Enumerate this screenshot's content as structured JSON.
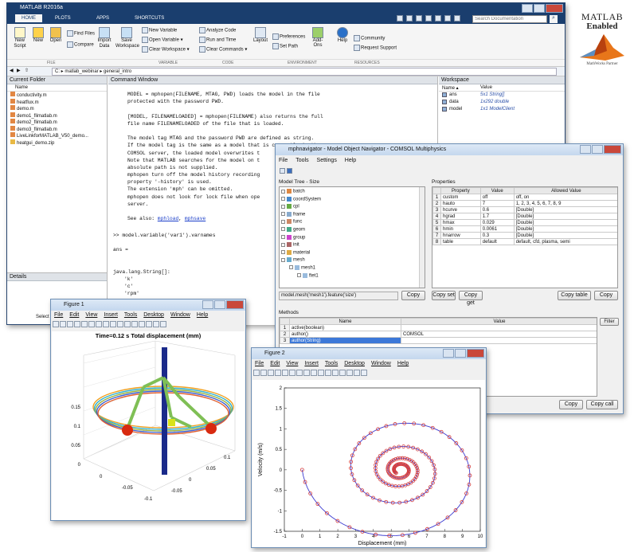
{
  "matlab": {
    "title": "MATLAB R2016a",
    "tabs": [
      "HOME",
      "PLOTS",
      "APPS",
      "SHORTCUTS"
    ],
    "search_placeholder": "Search Documentation",
    "ribbon": {
      "new_script": "New Script",
      "new": "New",
      "open": "Open",
      "find_files": "Find Files",
      "compare": "Compare",
      "import_data": "Import Data",
      "save_workspace": "Save Workspace",
      "new_variable": "New Variable",
      "open_variable": "Open Variable",
      "clear_workspace": "Clear Workspace",
      "analyze_code": "Analyze Code",
      "run_and_time": "Run and Time",
      "clear_commands": "Clear Commands",
      "layout": "Layout",
      "preferences": "Preferences",
      "set_path": "Set Path",
      "addons": "Add-Ons",
      "help": "Help",
      "community": "Community",
      "request_support": "Request Support",
      "groups": [
        "FILE",
        "VARIABLE",
        "CODE",
        "ENVIRONMENT",
        "RESOURCES"
      ]
    },
    "path": "C: ▸ matlab_webinar ▸ general_intro",
    "current_folder": {
      "title": "Current Folder",
      "col": "Name",
      "files": [
        "conductivity.m",
        "heatflux.m",
        "demo.m",
        "demo1_flimatlab.m",
        "demo2_flimatlab.m",
        "demo3_flimatlab.m",
        "LiveLinkforMATLAB_V50_demo...",
        "heatgui_demo.zip"
      ]
    },
    "details": {
      "title": "Details",
      "select": "Select a fil"
    },
    "command_window": {
      "title": "Command Window",
      "lines": [
        "MODEL = mphopen(FILENAME, MTAG, PWD) loads the model in the file",
        "protected with the password PWD.",
        "",
        "[MODEL, FILENAMELOADED] = mphopen(FILENAME) also returns the full",
        "file name FILENAMELOADED of the file that is loaded.",
        "",
        "The model tag MTAG and the password PWD are defined as string.",
        "If the model tag is the same as a model that is currently in the",
        "COMSOL server, the loaded model overwrites t",
        "Note that MATLAB searches for the model on t",
        "absolute path is not supplied.",
        "mphopen turn off the model history recording",
        "property '-history' is used.",
        "The extension 'mph' can be omitted.",
        "mphopen does not look for lock file when ope",
        "server."
      ],
      "see_also": "See also:",
      "link1": "mphload",
      "link2": "mphsave",
      "prompt": ">> model.variable('var1').varnames",
      "ans": "ans =",
      "java": "java.lang.String[]:",
      "vals": [
        "'k'",
        "'c'",
        "'rpm'"
      ]
    },
    "workspace": {
      "title": "Workspace",
      "cols": [
        "Name ▴",
        "Value"
      ],
      "rows": [
        [
          "ans",
          "5x1 String[]"
        ],
        [
          "data",
          "1x292 double"
        ],
        [
          "model",
          "1x1 ModelClient"
        ]
      ]
    }
  },
  "logo": {
    "name": "MATLAB",
    "enabled": "Enabled",
    "partner": "MathWorks Partner"
  },
  "navigator": {
    "title": "mphnavigator - Model Object Navigator - COMSOL Multiphysics",
    "menu": [
      "File",
      "Tools",
      "Settings",
      "Help"
    ],
    "tree_title": "Model Tree - Size",
    "tree": [
      "batch",
      "coordSystem",
      "cpl",
      "frame",
      "func",
      "geom",
      "group",
      "init",
      "material",
      "mesh",
      "mesh1",
      "ftet1"
    ],
    "tree_path": "model.mesh('mesh1').feature('size')",
    "copy": "Copy",
    "props_title": "Properties",
    "props_cols": [
      "Property",
      "Value",
      "Allowed Value"
    ],
    "props": [
      [
        "1",
        "custom",
        "off",
        "off, on"
      ],
      [
        "2",
        "hauto",
        "7",
        "1, 2, 3, 4, 5, 6, 7, 8, 9"
      ],
      [
        "3",
        "hcurve",
        "0.6",
        "[Double]"
      ],
      [
        "4",
        "hgrad",
        "1.7",
        "[Double]"
      ],
      [
        "5",
        "hmax",
        "0.029",
        "[Double]"
      ],
      [
        "6",
        "hmin",
        "0.0061",
        "[Double]"
      ],
      [
        "7",
        "hnarrow",
        "0.3",
        "[Double]"
      ],
      [
        "8",
        "table",
        "default",
        "default, cfd, plasma, semi"
      ]
    ],
    "copy_set": "Copy set",
    "copy_get": "Copy get",
    "copy_table": "Copy table",
    "methods_title": "Methods",
    "methods_cols": [
      "Name",
      "Value"
    ],
    "methods": [
      [
        "1",
        "active(boolean)",
        ""
      ],
      [
        "2",
        "author()",
        "COMSOL"
      ],
      [
        "3",
        "author(String)",
        ""
      ]
    ],
    "filter": "Filter",
    "copy_call": "Copy call"
  },
  "figure1": {
    "title": "Figure 1",
    "menu": [
      "File",
      "Edit",
      "View",
      "Insert",
      "Tools",
      "Desktop",
      "Window",
      "Help"
    ],
    "plot_title": "Time=0.12 s  Total displacement (mm)",
    "zticks": [
      "0.15",
      "0.1",
      "0.05",
      "0"
    ],
    "xticks": [
      "0",
      "-0.05",
      "-0.1"
    ],
    "yticks": [
      "-0.05",
      "0",
      "0.05",
      "0.1"
    ]
  },
  "figure2": {
    "title": "Figure 2",
    "menu": [
      "File",
      "Edit",
      "View",
      "Insert",
      "Tools",
      "Desktop",
      "Window",
      "Help"
    ],
    "xlabel": "Displacement (mm)",
    "ylabel": "Velocity (m/s)",
    "xticks": [
      "-1",
      "0",
      "1",
      "2",
      "3",
      "4",
      "5",
      "6",
      "7",
      "8",
      "9",
      "10"
    ],
    "yticks": [
      "2",
      "1.5",
      "1",
      "0.5",
      "0",
      "-0.5",
      "-1",
      "-1.5"
    ]
  },
  "colors": {
    "matlab_blue": "#1a3e6e",
    "ribbon": "#f5f5f5",
    "spiral_line": "#3b3bd1",
    "spiral_marker": "#d43a3a"
  }
}
